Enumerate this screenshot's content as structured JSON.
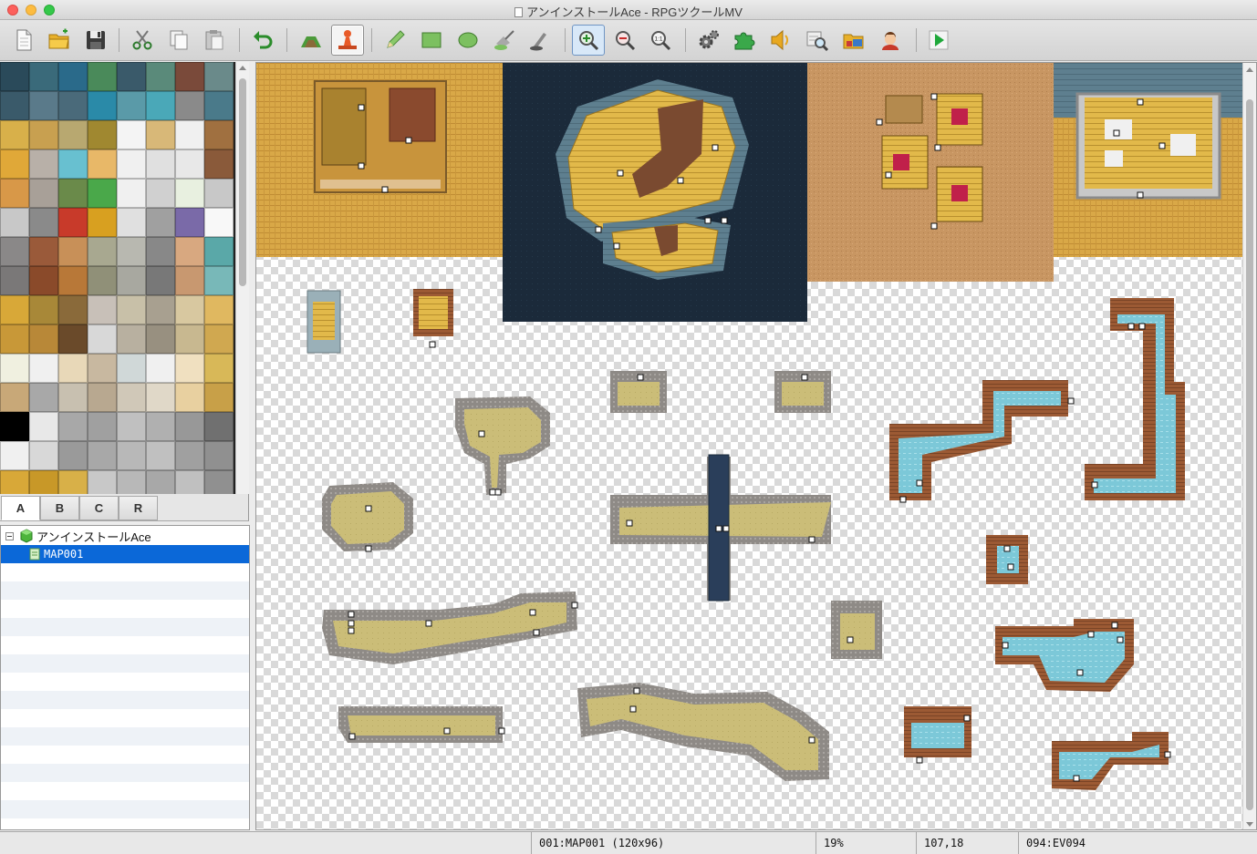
{
  "window": {
    "title": "アンインストールAce - RPGツクールMV"
  },
  "toolbar": {
    "buttons": [
      {
        "name": "new-project",
        "icon": "new-document-icon"
      },
      {
        "name": "open-project",
        "icon": "open-folder-icon"
      },
      {
        "name": "save-project",
        "icon": "save-disk-icon"
      },
      {
        "name": "cut",
        "icon": "scissors-icon"
      },
      {
        "name": "copy",
        "icon": "copy-icon"
      },
      {
        "name": "paste",
        "icon": "paste-clipboard-icon"
      },
      {
        "name": "undo",
        "icon": "undo-arrow-icon"
      },
      {
        "name": "map-mode",
        "icon": "map-mode-icon"
      },
      {
        "name": "event-mode",
        "icon": "event-mode-icon"
      },
      {
        "name": "pencil",
        "icon": "pencil-icon"
      },
      {
        "name": "rectangle",
        "icon": "rectangle-icon"
      },
      {
        "name": "ellipse",
        "icon": "ellipse-icon"
      },
      {
        "name": "flood-fill",
        "icon": "fill-bucket-icon"
      },
      {
        "name": "shadow-pen",
        "icon": "shadow-pen-icon"
      },
      {
        "name": "zoom-in",
        "icon": "zoom-in-icon"
      },
      {
        "name": "zoom-out",
        "icon": "zoom-out-icon"
      },
      {
        "name": "actual-size",
        "icon": "zoom-actual-size-icon",
        "label": "1:1"
      },
      {
        "name": "database",
        "icon": "gear-database-icon"
      },
      {
        "name": "plugin-manager",
        "icon": "puzzle-plugin-icon"
      },
      {
        "name": "sound-test",
        "icon": "speaker-icon"
      },
      {
        "name": "event-searcher",
        "icon": "event-search-icon"
      },
      {
        "name": "resource-manager",
        "icon": "resource-folder-icon"
      },
      {
        "name": "character-generator",
        "icon": "character-face-icon"
      },
      {
        "name": "playtest",
        "icon": "play-triangle-icon"
      }
    ]
  },
  "palette": {
    "tabs": [
      "A",
      "B",
      "C",
      "R"
    ],
    "selected_tab": "A"
  },
  "map_tree": {
    "project": "アンインストールAce",
    "maps": [
      {
        "label": "MAP001",
        "selected": true
      }
    ]
  },
  "status": {
    "map": "001:MAP001 (120x96)",
    "zoom": "19%",
    "coords": "107,18",
    "event": "094:EV094"
  },
  "colors": {
    "selection_blue": "#0b68d8",
    "sand_wall": "#d8a84a",
    "water_dark": "#1b2a3a",
    "dirt_floor": "#c89662",
    "stone_floor": "#5e7f8f",
    "cave_floor": "#cbbd78",
    "cave_wall": "#8e8a86",
    "water_light": "#7cc8d8",
    "brick": "#9c5a34"
  }
}
